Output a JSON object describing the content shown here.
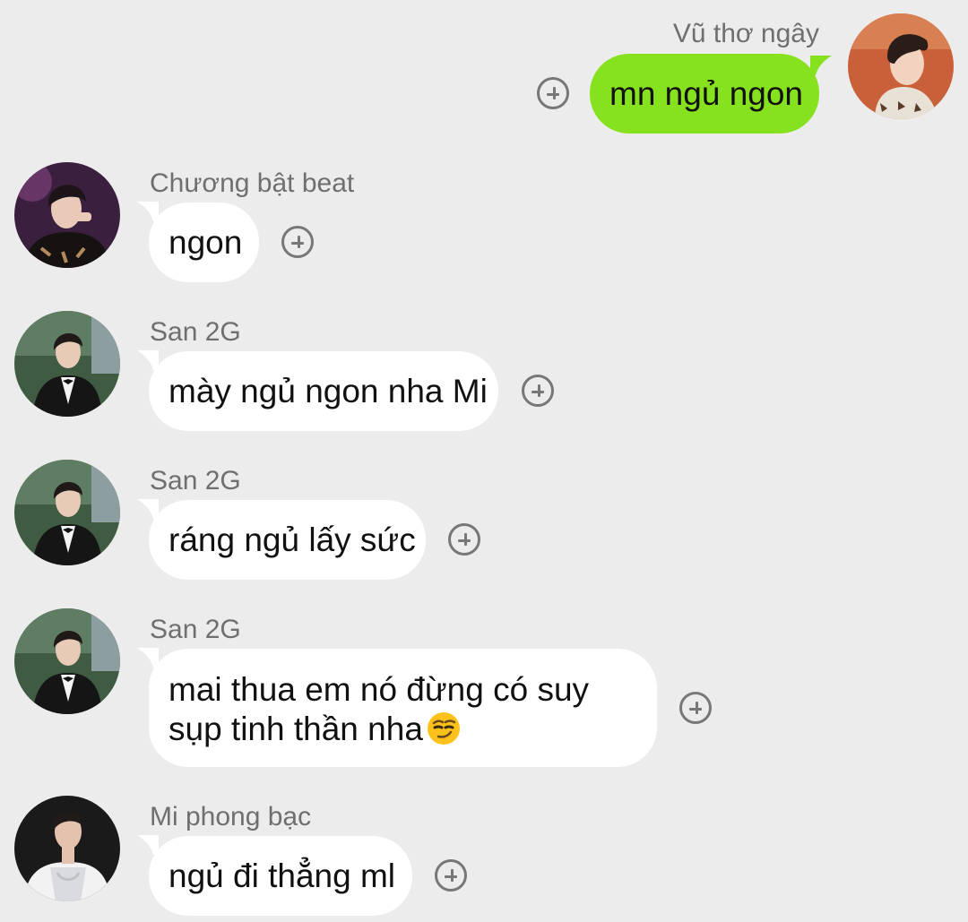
{
  "messages": [
    {
      "sender": "Vũ thơ ngây",
      "text": "mn ngủ ngon",
      "own": true,
      "avatar": "avatar-vu-tho-ngay"
    },
    {
      "sender": "Chương bật beat",
      "text": "ngon",
      "own": false,
      "avatar": "avatar-chuong-bat-beat"
    },
    {
      "sender": "San 2G",
      "text": "mày ngủ ngon nha Mi",
      "own": false,
      "avatar": "avatar-san-2g"
    },
    {
      "sender": "San 2G",
      "text": "ráng ngủ lấy sức",
      "own": false,
      "avatar": "avatar-san-2g"
    },
    {
      "sender": "San 2G",
      "text_line1": "mai thua em nó đừng có suy",
      "text_line2": "sụp tinh thần nha",
      "emoji": "smirking-face-emoji",
      "own": false,
      "avatar": "avatar-san-2g"
    },
    {
      "sender": "Mi phong bạc",
      "text": "ngủ đi thẳng ml",
      "own": false,
      "avatar": "avatar-mi-phong-bac"
    }
  ],
  "colors": {
    "background": "#ececec",
    "own_bubble": "#86e11f",
    "other_bubble": "#ffffff",
    "sender_name": "#6f6f6f",
    "reaction_icon": "#777777"
  },
  "icons": {
    "reaction": "add-reaction-icon"
  }
}
